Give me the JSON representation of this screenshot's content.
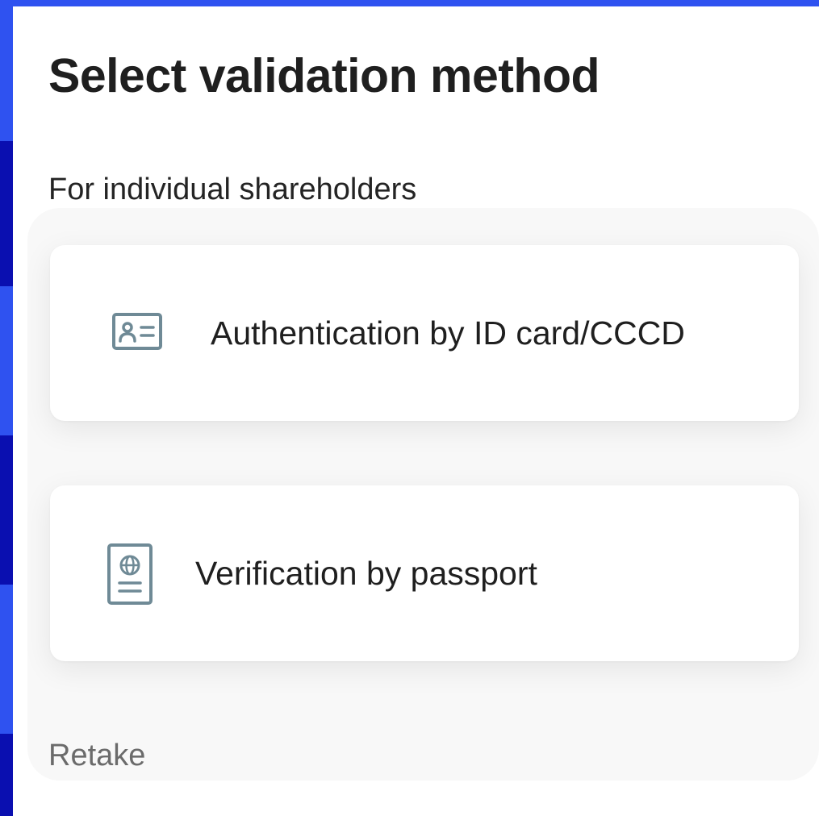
{
  "header": {
    "title": "Select validation method"
  },
  "section": {
    "label": "For individual shareholders"
  },
  "options": [
    {
      "label": "Authentication by ID card/CCCD",
      "icon": "id-card-icon"
    },
    {
      "label": "Verification by passport",
      "icon": "passport-icon"
    }
  ],
  "footer": {
    "retake_label": "Retake"
  },
  "colors": {
    "frame_accent": "#2f52f0",
    "frame_edge": "#0a0fb0",
    "text_primary": "#1f1f1f",
    "text_muted": "#6b6b6b",
    "icon_stroke": "#6f8a96",
    "panel_bg": "#f8f8f8",
    "card_bg": "#ffffff"
  }
}
